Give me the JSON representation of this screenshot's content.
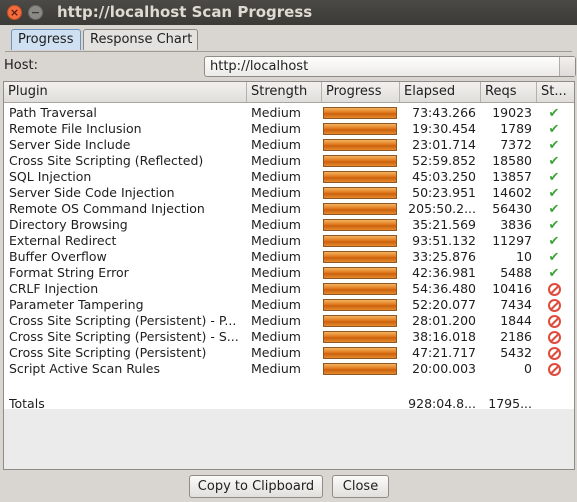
{
  "window": {
    "title": "http://localhost Scan Progress",
    "close_glyph": "×",
    "min_glyph": "−"
  },
  "tabs": [
    {
      "label": "Progress",
      "active": true
    },
    {
      "label": "Response Chart",
      "active": false
    }
  ],
  "host": {
    "label": "Host:",
    "value": "http://localhost"
  },
  "table": {
    "columns": [
      "Plugin",
      "Strength",
      "Progress",
      "Elapsed",
      "Reqs",
      "St..."
    ],
    "rows": [
      {
        "plugin": "Path Traversal",
        "strength": "Medium",
        "progress": 1.0,
        "elapsed": "73:43.266",
        "reqs": "19023",
        "status": "ok"
      },
      {
        "plugin": "Remote File Inclusion",
        "strength": "Medium",
        "progress": 1.0,
        "elapsed": "19:30.454",
        "reqs": "1789",
        "status": "ok"
      },
      {
        "plugin": "Server Side Include",
        "strength": "Medium",
        "progress": 1.0,
        "elapsed": "23:01.714",
        "reqs": "7372",
        "status": "ok"
      },
      {
        "plugin": "Cross Site Scripting (Reflected)",
        "strength": "Medium",
        "progress": 1.0,
        "elapsed": "52:59.852",
        "reqs": "18580",
        "status": "ok"
      },
      {
        "plugin": "SQL Injection",
        "strength": "Medium",
        "progress": 1.0,
        "elapsed": "45:03.250",
        "reqs": "13857",
        "status": "ok"
      },
      {
        "plugin": "Server Side Code Injection",
        "strength": "Medium",
        "progress": 1.0,
        "elapsed": "50:23.951",
        "reqs": "14602",
        "status": "ok"
      },
      {
        "plugin": "Remote OS Command Injection",
        "strength": "Medium",
        "progress": 1.0,
        "elapsed": "205:50.2...",
        "reqs": "56430",
        "status": "ok"
      },
      {
        "plugin": "Directory Browsing",
        "strength": "Medium",
        "progress": 1.0,
        "elapsed": "35:21.569",
        "reqs": "3836",
        "status": "ok"
      },
      {
        "plugin": "External Redirect",
        "strength": "Medium",
        "progress": 1.0,
        "elapsed": "93:51.132",
        "reqs": "11297",
        "status": "ok"
      },
      {
        "plugin": "Buffer Overflow",
        "strength": "Medium",
        "progress": 1.0,
        "elapsed": "33:25.876",
        "reqs": "10",
        "status": "ok"
      },
      {
        "plugin": "Format String Error",
        "strength": "Medium",
        "progress": 1.0,
        "elapsed": "42:36.981",
        "reqs": "5488",
        "status": "ok"
      },
      {
        "plugin": "CRLF Injection",
        "strength": "Medium",
        "progress": 1.0,
        "elapsed": "54:36.480",
        "reqs": "10416",
        "status": "stopped"
      },
      {
        "plugin": "Parameter Tampering",
        "strength": "Medium",
        "progress": 1.0,
        "elapsed": "52:20.077",
        "reqs": "7434",
        "status": "stopped"
      },
      {
        "plugin": "Cross Site Scripting (Persistent) - P...",
        "strength": "Medium",
        "progress": 1.0,
        "elapsed": "28:01.200",
        "reqs": "1844",
        "status": "stopped"
      },
      {
        "plugin": "Cross Site Scripting (Persistent) - S...",
        "strength": "Medium",
        "progress": 1.0,
        "elapsed": "38:16.018",
        "reqs": "2186",
        "status": "stopped"
      },
      {
        "plugin": "Cross Site Scripting (Persistent)",
        "strength": "Medium",
        "progress": 1.0,
        "elapsed": "47:21.717",
        "reqs": "5432",
        "status": "stopped"
      },
      {
        "plugin": "Script Active Scan Rules",
        "strength": "Medium",
        "progress": 1.0,
        "elapsed": "20:00.003",
        "reqs": "0",
        "status": "stopped"
      }
    ],
    "totals": {
      "label": "Totals",
      "elapsed": "928:04.8...",
      "reqs": "1795..."
    }
  },
  "status_icons": {
    "ok": "check-icon",
    "stopped": "stop-icon"
  },
  "colors": {
    "progress_bar": "#e37b1d",
    "ok": "#3aa53a",
    "stopped": "#e04a3a",
    "tab_active": "#cfe0f2"
  },
  "buttons": {
    "copy": "Copy to Clipboard",
    "close": "Close"
  }
}
